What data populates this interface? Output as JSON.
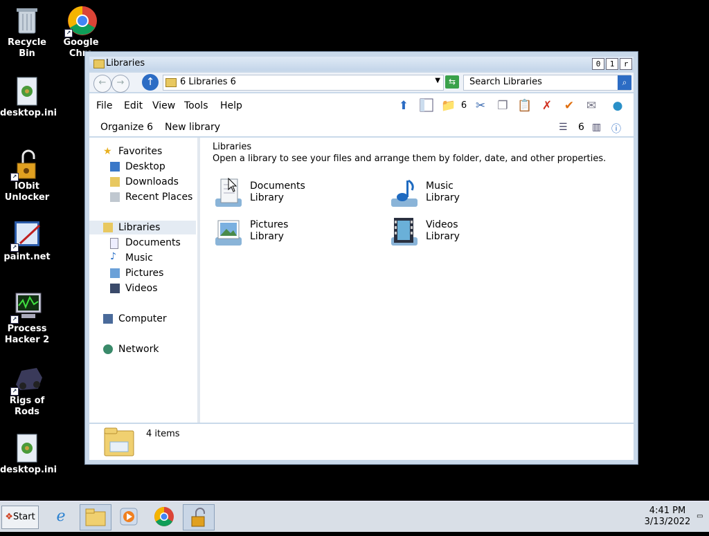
{
  "desktop": {
    "icons": [
      {
        "label": "Recycle\nBin"
      },
      {
        "label": "Google\nChro"
      },
      {
        "label": "desktop.ini"
      },
      {
        "label": "IObit\nUnlocker"
      },
      {
        "label": "paint.net"
      },
      {
        "label": "Process\nHacker 2"
      },
      {
        "label": "Rigs of\nRods"
      },
      {
        "label": "desktop.ini"
      }
    ]
  },
  "window": {
    "title": "Libraries",
    "buttons": {
      "minimize": "0",
      "maximize": "1",
      "close": "r"
    },
    "address": "6 Libraries 6",
    "search_placeholder": "Search Libraries",
    "menu": {
      "file": "File",
      "edit": "Edit",
      "view": "View",
      "tools": "Tools",
      "help": "Help"
    },
    "toolbar_count": "6",
    "command": {
      "organize": "Organize 6",
      "new_library": "New library",
      "view_count": "6"
    },
    "nav": {
      "favorites": "Favorites",
      "desktop": "Desktop",
      "downloads": "Downloads",
      "recent": "Recent Places",
      "libraries": "Libraries",
      "documents": "Documents",
      "music": "Music",
      "pictures": "Pictures",
      "videos": "Videos",
      "computer": "Computer",
      "network": "Network"
    },
    "content": {
      "title": "Libraries",
      "description": "Open a library to see your files and arrange them by folder, date, and other properties.",
      "libraries": [
        {
          "name": "Documents",
          "sub": "Library",
          "icon": "documents-library-icon"
        },
        {
          "name": "Music",
          "sub": "Library",
          "icon": "music-library-icon"
        },
        {
          "name": "Pictures",
          "sub": "Library",
          "icon": "pictures-library-icon"
        },
        {
          "name": "Videos",
          "sub": "Library",
          "icon": "videos-library-icon"
        }
      ]
    },
    "status": "4 items"
  },
  "taskbar": {
    "start": "Start",
    "time": "4:41 PM",
    "date": "3/13/2022"
  }
}
